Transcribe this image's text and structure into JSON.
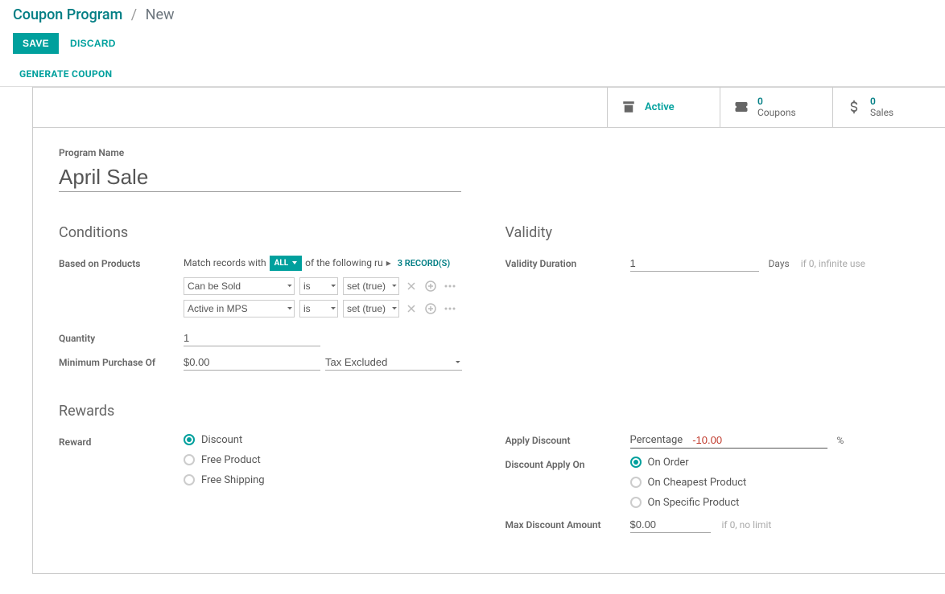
{
  "breadcrumb": {
    "parent": "Coupon Program",
    "current": "New"
  },
  "buttons": {
    "save": "SAVE",
    "discard": "DISCARD",
    "generate": "GENERATE COUPON"
  },
  "stats": {
    "active": "Active",
    "coupons": {
      "count": "0",
      "label": "Coupons"
    },
    "sales": {
      "count": "0",
      "label": "Sales"
    }
  },
  "program": {
    "label": "Program Name",
    "value": "April Sale"
  },
  "sections": {
    "conditions": "Conditions",
    "validity": "Validity",
    "rewards": "Rewards"
  },
  "conditions": {
    "based_label": "Based on Products",
    "match_prefix": "Match records with",
    "match_all": "ALL",
    "match_suffix": "of the following ru",
    "records_link": "3 RECORD(S)",
    "rules": [
      {
        "field": "Can be Sold",
        "op": "is",
        "val": "set (true)"
      },
      {
        "field": "Active in MPS",
        "op": "is",
        "val": "set (true)"
      }
    ],
    "quantity_label": "Quantity",
    "quantity_value": "1",
    "min_label": "Minimum Purchase Of",
    "min_value": "$0.00",
    "tax_value": "Tax Excluded"
  },
  "validity": {
    "duration_label": "Validity Duration",
    "duration_value": "1",
    "unit": "Days",
    "hint": "if 0, infinite use"
  },
  "rewards": {
    "reward_label": "Reward",
    "options": [
      "Discount",
      "Free Product",
      "Free Shipping"
    ],
    "selected": 0
  },
  "discount": {
    "apply_label": "Apply Discount",
    "type": "Percentage",
    "value": "-10.00",
    "unit": "%",
    "apply_on_label": "Discount Apply On",
    "apply_on_options": [
      "On Order",
      "On Cheapest Product",
      "On Specific Product"
    ],
    "apply_on_selected": 0,
    "max_label": "Max Discount Amount",
    "max_value": "$0.00",
    "max_hint": "if 0, no limit"
  }
}
